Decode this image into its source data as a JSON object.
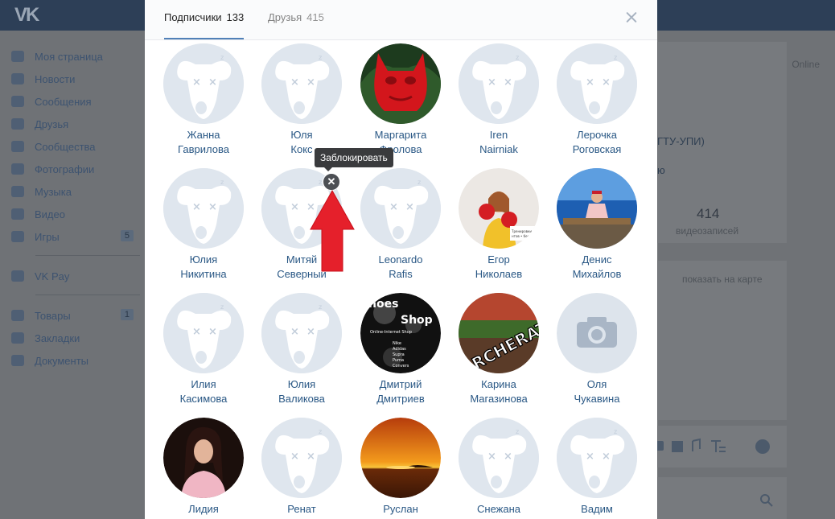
{
  "background": {
    "logo": "VK",
    "sidebar": [
      {
        "label": "Моя страница",
        "icon": "home-icon"
      },
      {
        "label": "Новости",
        "icon": "news-icon"
      },
      {
        "label": "Сообщения",
        "icon": "messages-icon"
      },
      {
        "label": "Друзья",
        "icon": "friends-icon"
      },
      {
        "label": "Сообщества",
        "icon": "groups-icon"
      },
      {
        "label": "Фотографии",
        "icon": "camera-icon"
      },
      {
        "label": "Музыка",
        "icon": "music-icon"
      },
      {
        "label": "Видео",
        "icon": "video-icon"
      },
      {
        "label": "Игры",
        "icon": "games-icon",
        "count": "5"
      },
      {
        "label": "VK Pay",
        "icon": "vkpay-icon"
      },
      {
        "label": "Товары",
        "icon": "goods-icon",
        "count": "1"
      },
      {
        "label": "Закладки",
        "icon": "star-icon"
      },
      {
        "label": "Документы",
        "icon": "documents-icon"
      }
    ],
    "right": {
      "online": "Online",
      "univ": "ГТУ-УПИ)",
      "partial": "ю",
      "videos_count": "414",
      "videos_label": "видеозаписей",
      "map_link": "показать на карте"
    }
  },
  "modal": {
    "tabs": [
      {
        "label": "Подписчики",
        "count": "133",
        "active": true
      },
      {
        "label": "Друзья",
        "count": "415",
        "active": false
      }
    ],
    "tooltip": "Заблокировать",
    "block_symbol": "✕",
    "people": [
      {
        "first": "Жанна",
        "last": "Гаврилова",
        "avatar": "default"
      },
      {
        "first": "Юля",
        "last": "Кокс",
        "avatar": "default"
      },
      {
        "first": "Маргарита",
        "last": "Фролова",
        "avatar": "red-statue"
      },
      {
        "first": "Iren",
        "last": "Nairniak",
        "avatar": "default"
      },
      {
        "first": "Лерочка",
        "last": "Роговская",
        "avatar": "default"
      },
      {
        "first": "Юлия",
        "last": "Никитина",
        "avatar": "default"
      },
      {
        "first": "Митяй",
        "last": "Северный",
        "avatar": "default"
      },
      {
        "first": "Leonardo",
        "last": "Rafis",
        "avatar": "default"
      },
      {
        "first": "Егор",
        "last": "Николаев",
        "avatar": "boxer-photo"
      },
      {
        "first": "Денис",
        "last": "Михайлов",
        "avatar": "sea-photo"
      },
      {
        "first": "Илия",
        "last": "Касимова",
        "avatar": "default"
      },
      {
        "first": "Юлия",
        "last": "Валикова",
        "avatar": "default"
      },
      {
        "first": "Дмитрий",
        "last": "Дмитриев",
        "avatar": "shoes-shop"
      },
      {
        "first": "Карина",
        "last": "Магазинова",
        "avatar": "graffiti-photo"
      },
      {
        "first": "Оля",
        "last": "Чукавина",
        "avatar": "camera-placeholder"
      },
      {
        "first": "Лидия",
        "last": "",
        "avatar": "woman-photo"
      },
      {
        "first": "Ренат",
        "last": "",
        "avatar": "default"
      },
      {
        "first": "Руслан",
        "last": "",
        "avatar": "sunset-photo"
      },
      {
        "first": "Снежана",
        "last": "",
        "avatar": "default"
      },
      {
        "first": "Вадим",
        "last": "",
        "avatar": "default"
      }
    ],
    "shoes_avatar_text": {
      "line1": "hoes",
      "line2": "Shop",
      "line3": "Online-Internet Shop",
      "brands": [
        "Nike",
        "Adidas",
        "Supra",
        "Puma",
        "Convers"
      ]
    },
    "graffiti_text": "RCHERAT",
    "boxer_caption": "Тренировки для студентов • бесплатно!!!"
  },
  "colors": {
    "accent": "#5181b8",
    "link": "#2a5885",
    "header": "#2d3f57",
    "arrow": "#e5202b"
  }
}
